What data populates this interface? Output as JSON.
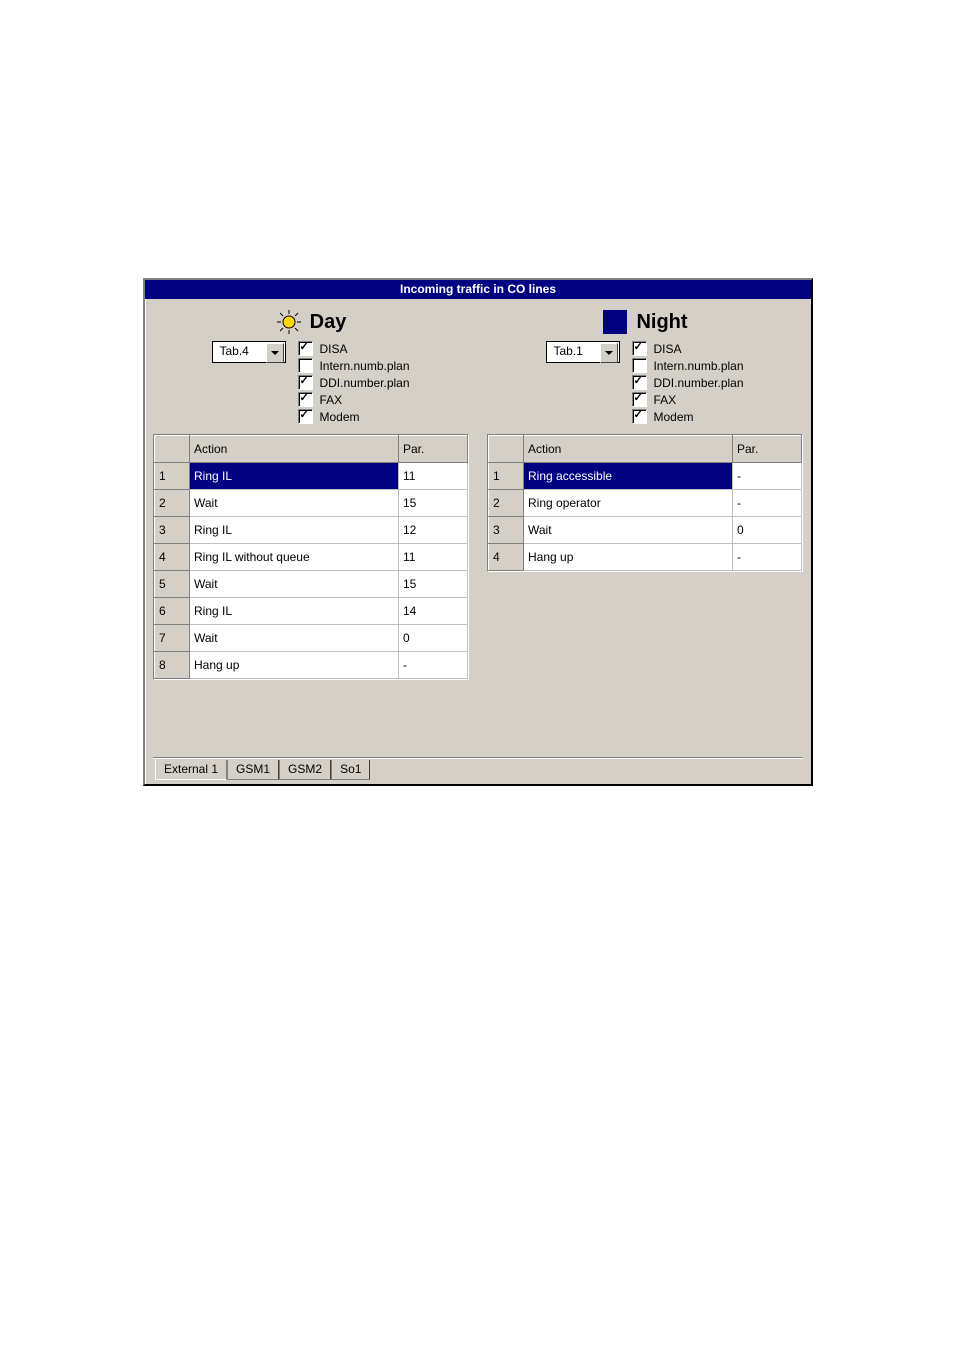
{
  "title": "Incoming traffic in CO lines",
  "day": {
    "label": "Day",
    "tab_select": "Tab.4",
    "checks": [
      {
        "label": "DISA",
        "checked": true
      },
      {
        "label": "Intern.numb.plan",
        "checked": false
      },
      {
        "label": "DDI.number.plan",
        "checked": true
      },
      {
        "label": "FAX",
        "checked": true
      },
      {
        "label": "Modem",
        "checked": true
      }
    ],
    "headers": {
      "action": "Action",
      "par": "Par."
    },
    "rows": [
      {
        "n": "1",
        "action": "Ring IL",
        "par": "11",
        "sel": true
      },
      {
        "n": "2",
        "action": "Wait",
        "par": "15",
        "sel": false
      },
      {
        "n": "3",
        "action": "Ring IL",
        "par": "12",
        "sel": false
      },
      {
        "n": "4",
        "action": "Ring IL without queue",
        "par": "11",
        "sel": false
      },
      {
        "n": "5",
        "action": "Wait",
        "par": "15",
        "sel": false
      },
      {
        "n": "6",
        "action": "Ring IL",
        "par": "14",
        "sel": false
      },
      {
        "n": "7",
        "action": "Wait",
        "par": "0",
        "sel": false
      },
      {
        "n": "8",
        "action": "Hang up",
        "par": "-",
        "sel": false
      }
    ]
  },
  "night": {
    "label": "Night",
    "tab_select": "Tab.1",
    "checks": [
      {
        "label": "DISA",
        "checked": true
      },
      {
        "label": "Intern.numb.plan",
        "checked": false
      },
      {
        "label": "DDI.number.plan",
        "checked": true
      },
      {
        "label": "FAX",
        "checked": true
      },
      {
        "label": "Modem",
        "checked": true
      }
    ],
    "headers": {
      "action": "Action",
      "par": "Par."
    },
    "rows": [
      {
        "n": "1",
        "action": "Ring accessible",
        "par": "-",
        "sel": true
      },
      {
        "n": "2",
        "action": "Ring operator",
        "par": "-",
        "sel": false
      },
      {
        "n": "3",
        "action": "Wait",
        "par": "0",
        "sel": false
      },
      {
        "n": "4",
        "action": "Hang up",
        "par": "-",
        "sel": false
      }
    ]
  },
  "tabs": [
    {
      "label": "External 1",
      "active": true
    },
    {
      "label": "GSM1",
      "active": false
    },
    {
      "label": "GSM2",
      "active": false
    },
    {
      "label": "So1",
      "active": false
    }
  ]
}
